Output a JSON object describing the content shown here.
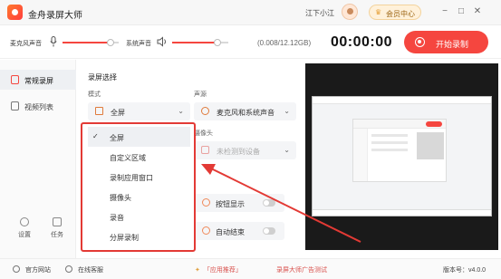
{
  "app": {
    "title": "金舟录屏大师"
  },
  "titlebar": {
    "username": "江下小江",
    "vip_label": "会员中心",
    "minimize": "−",
    "maximize": "□",
    "close": "✕"
  },
  "audio": {
    "mic_label": "麦克风声音",
    "mic_level": 0.85,
    "system_label": "系统声音",
    "system_level": 0.8,
    "size_text": "(0.008/12.12GB)"
  },
  "timer": "00:00:00",
  "record_button": "开始录制",
  "sidebar": {
    "items": [
      {
        "label": "常规录屏",
        "active": true
      },
      {
        "label": "视频列表",
        "active": false
      }
    ],
    "bottom": [
      {
        "label": "设置"
      },
      {
        "label": "任务"
      }
    ]
  },
  "main": {
    "section_title": "录屏选择",
    "mode_label": "模式",
    "mode_value": "全屏",
    "audio_source_label": "声源",
    "audio_source_value": "麦克风和系统声音",
    "camera_label": "摄像头",
    "camera_value": "未检测到设备",
    "button_display_label": "按钮显示",
    "auto_end_label": "自动结束",
    "chevron": "⌄"
  },
  "dropdown": {
    "check": "✓",
    "options": [
      {
        "label": "全屏",
        "selected": true
      },
      {
        "label": "自定义区域",
        "selected": false
      },
      {
        "label": "录制应用窗口",
        "selected": false
      },
      {
        "label": "摄像头",
        "selected": false
      },
      {
        "label": "录音",
        "selected": false
      },
      {
        "label": "分屏录制",
        "selected": false
      }
    ]
  },
  "footer": {
    "website": "官方网站",
    "support": "在线客服",
    "promo1": "「应用推荐」",
    "promo2": "录屏大师广告测试",
    "version": "版本号：v4.0.0"
  },
  "colors": {
    "accent": "#f5463f",
    "highlight": "#e33a35"
  }
}
